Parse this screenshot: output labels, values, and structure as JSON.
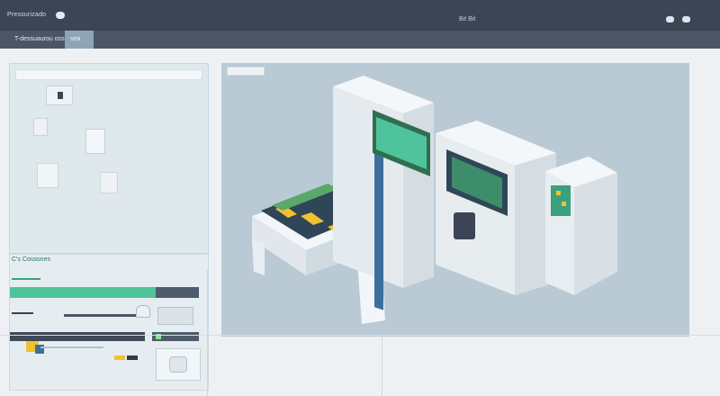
{
  "header": {
    "brand": "Pressurizado",
    "title": "Bit Bit"
  },
  "subnav": {
    "tabs": [
      {
        "label": "T-dessuaurou ossse"
      },
      {
        "label": "sea"
      }
    ]
  },
  "lower_panel": {
    "title": "C's Coussnes"
  },
  "colors": {
    "topbar": "#3b4556",
    "accent_green": "#4fc39b",
    "accent_yellow": "#f2c131",
    "main_bg": "#b9cad5"
  },
  "icons": {
    "toggle": "pill-toggle-icon",
    "machine": "industrial-machine-illustration"
  }
}
